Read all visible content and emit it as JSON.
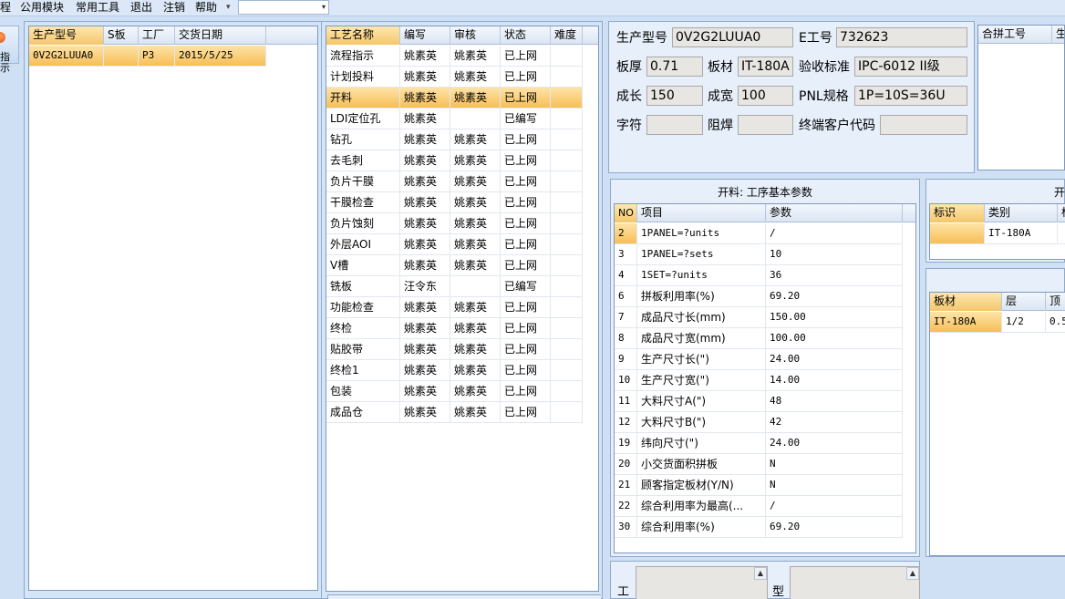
{
  "menu": {
    "items": [
      "程",
      "公用模块",
      "常用工具",
      "退出",
      "注销",
      "帮助"
    ],
    "dropdown_arrow": "▾",
    "combo_value": "",
    "combo_arrow": "▾"
  },
  "toolbar": {
    "stop_label": "指示"
  },
  "orders": {
    "columns": [
      "生产型号",
      "S板",
      "工厂",
      "交货日期"
    ],
    "rows": [
      [
        "0V2G2LUUA0",
        "",
        "P3",
        "2015/5/25"
      ]
    ]
  },
  "processes": {
    "columns": [
      "工艺名称",
      "编写",
      "审核",
      "状态",
      "难度"
    ],
    "rows": [
      [
        "流程指示",
        "姚素英",
        "姚素英",
        "已上网",
        ""
      ],
      [
        "计划投料",
        "姚素英",
        "姚素英",
        "已上网",
        ""
      ],
      [
        "开料",
        "姚素英",
        "姚素英",
        "已上网",
        ""
      ],
      [
        "LDI定位孔",
        "姚素英",
        "",
        "已编写",
        ""
      ],
      [
        "钻孔",
        "姚素英",
        "姚素英",
        "已上网",
        ""
      ],
      [
        "去毛刺",
        "姚素英",
        "姚素英",
        "已上网",
        ""
      ],
      [
        "负片干膜",
        "姚素英",
        "姚素英",
        "已上网",
        ""
      ],
      [
        "干膜检查",
        "姚素英",
        "姚素英",
        "已上网",
        ""
      ],
      [
        "负片蚀刻",
        "姚素英",
        "姚素英",
        "已上网",
        ""
      ],
      [
        "外层AOI",
        "姚素英",
        "姚素英",
        "已上网",
        ""
      ],
      [
        "V槽",
        "姚素英",
        "姚素英",
        "已上网",
        ""
      ],
      [
        "铣板",
        "汪令东",
        "",
        "已编写",
        ""
      ],
      [
        "功能检查",
        "姚素英",
        "姚素英",
        "已上网",
        ""
      ],
      [
        "终检",
        "姚素英",
        "姚素英",
        "已上网",
        ""
      ],
      [
        "贴胶带",
        "姚素英",
        "姚素英",
        "已上网",
        ""
      ],
      [
        "终检1",
        "姚素英",
        "姚素英",
        "已上网",
        ""
      ],
      [
        "包装",
        "姚素英",
        "姚素英",
        "已上网",
        ""
      ],
      [
        "成品仓",
        "姚素英",
        "姚素英",
        "已上网",
        ""
      ]
    ]
  },
  "info": {
    "model_label": "生产型号",
    "model_value": "0V2G2LUUA0",
    "eng_label": "E工号",
    "eng_value": "732623",
    "thick_label": "板厚",
    "thick_value": "0.71",
    "mat_label": "板材",
    "mat_value": "IT-180A",
    "std_label": "验收标准",
    "std_value": "IPC-6012 II级",
    "len_label": "成长",
    "len_value": "150",
    "wid_label": "成宽",
    "wid_value": "100",
    "pnl_label": "PNL规格",
    "pnl_value": "1P=10S=36U",
    "char_label": "字符",
    "char_value": "",
    "mask_label": "阻焊",
    "mask_value": "",
    "cust_label": "终端客户代码",
    "cust_value": ""
  },
  "merge": {
    "columns": [
      "合拼工号",
      "生"
    ]
  },
  "params": {
    "title": "开料: 工序基本参数",
    "columns": [
      "NO",
      "项目",
      "参数"
    ],
    "rows": [
      [
        "2",
        "1PANEL=?units",
        "/"
      ],
      [
        "3",
        "1PANEL=?sets",
        "10"
      ],
      [
        "4",
        "1SET=?units",
        "36"
      ],
      [
        "6",
        "拼板利用率(%)",
        "69.20"
      ],
      [
        "7",
        "成品尺寸长(mm)",
        "150.00"
      ],
      [
        "8",
        "成品尺寸宽(mm)",
        "100.00"
      ],
      [
        "9",
        "生产尺寸长(\")",
        "24.00"
      ],
      [
        "10",
        "生产尺寸宽(\")",
        "14.00"
      ],
      [
        "11",
        "大料尺寸A(\")",
        "48"
      ],
      [
        "12",
        "大料尺寸B(\")",
        "42"
      ],
      [
        "19",
        "纬向尺寸(\")",
        "24.00"
      ],
      [
        "20",
        "小交货面积拼板",
        "N"
      ],
      [
        "21",
        "顾客指定板材(Y/N)",
        "N"
      ],
      [
        "22",
        "综合利用率为最高(...",
        "/"
      ],
      [
        "30",
        "综合利用率(%)",
        "69.20"
      ]
    ]
  },
  "right_top": {
    "title": "开",
    "columns": [
      "标识",
      "类别",
      "标"
    ],
    "rows": [
      [
        "",
        "IT-180A",
        ""
      ]
    ]
  },
  "right_bottom": {
    "columns": [
      "板材",
      "层",
      "顶"
    ],
    "rows": [
      [
        "IT-180A",
        "1/2",
        "0.5"
      ]
    ]
  },
  "bottom": {
    "label_a": "工",
    "label_b": "型",
    "scroll_up": "▲"
  }
}
